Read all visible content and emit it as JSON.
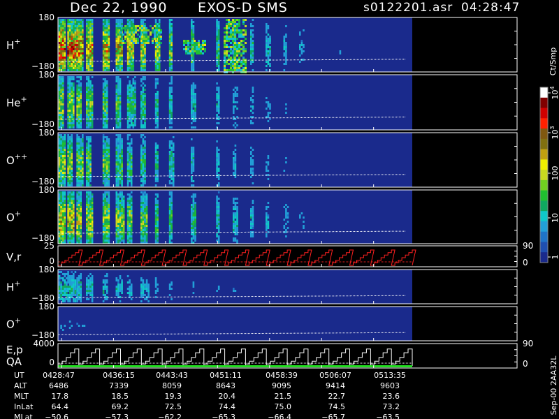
{
  "header": {
    "date": "Dec 22, 1990",
    "instrument": "EXOS-D SMS",
    "file": "s0122201.asr",
    "time": "04:28:47"
  },
  "colorbar": {
    "label": "Ct/Smp",
    "ticks": [
      "1",
      "10",
      "100",
      "10",
      "10"
    ],
    "tick_exponents": [
      "",
      "",
      "",
      "3",
      "4"
    ],
    "colors": [
      "#1a2a8c",
      "#1f4fb0",
      "#1f74c8",
      "#22a0d8",
      "#10c8c8",
      "#0fa860",
      "#20c030",
      "#70d020",
      "#c8d820",
      "#f0f000",
      "#c0a010",
      "#807010",
      "#805810",
      "#ff2000",
      "#d00000",
      "#800000",
      "#ffffff"
    ]
  },
  "panels": [
    {
      "label": "H",
      "sup": "+",
      "ymax": "180",
      "ymin": "−180"
    },
    {
      "label": "He",
      "sup": "+",
      "ymax": "180",
      "ymin": "−180"
    },
    {
      "label": "O",
      "sup": "++",
      "ymax": "180",
      "ymin": "−180"
    },
    {
      "label": "O",
      "sup": "+",
      "ymax": "180",
      "ymin": "−180"
    },
    {
      "label": "V,r",
      "sup": "",
      "ymax": "25",
      "ymin": "0",
      "right_max": "90",
      "right_min": "0"
    },
    {
      "label": "H",
      "sup": "+",
      "ymax": "180",
      "ymin": "−180"
    },
    {
      "label": "O",
      "sup": "+",
      "ymax": "180",
      "ymin": "−180"
    },
    {
      "label": "E,p",
      "sup": "",
      "label2": "QA",
      "ymax": "4000",
      "ymin": "0",
      "right_max": "90",
      "right_min": "0"
    }
  ],
  "side_note": "Sep-00 2AA32L",
  "ephemeris": {
    "rows": [
      {
        "name": "UT",
        "values": [
          "0428:47",
          "0436:15",
          "0443:43",
          "0451:11",
          "0458:39",
          "0506:07",
          "0513:35"
        ]
      },
      {
        "name": "ALT",
        "values": [
          "6486",
          "7339",
          "8059",
          "8643",
          "9095",
          "9414",
          "9603"
        ]
      },
      {
        "name": "MLT",
        "values": [
          "17.8",
          "18.5",
          "19.3",
          "20.4",
          "21.5",
          "22.7",
          "23.6"
        ]
      },
      {
        "name": "InLat",
        "values": [
          "64.4",
          "69.2",
          "72.5",
          "74.4",
          "75.0",
          "74.5",
          "73.2"
        ]
      },
      {
        "name": "MLat",
        "values": [
          "−50.6",
          "−57.3",
          "−62.2",
          "−65.3",
          "−66.4",
          "−65.7",
          "−63.5"
        ]
      }
    ]
  },
  "chart_data": {
    "type": "heatmap",
    "title": "Dec 22, 1990   EXOS-D SMS",
    "x_ticks": [
      "0428:47",
      "0436:15",
      "0443:43",
      "0451:11",
      "0458:39",
      "0506:07",
      "0513:35"
    ],
    "x_tick_positions_fraction": [
      0.0,
      0.1483,
      0.2966,
      0.4449,
      0.5932,
      0.7415,
      0.8898
    ],
    "data_end_fraction": 1.0,
    "colorbar_scale": "log",
    "colorbar_range": [
      1,
      10000
    ],
    "line_panels": [
      {
        "panel": "V,r",
        "type": "sawtooth",
        "periods": 17,
        "y_range": [
          0,
          25
        ],
        "color": "#ff2020"
      },
      {
        "panel": "E,p",
        "type": "staircase",
        "periods": 17,
        "y_range": [
          0,
          4000
        ],
        "color": "#ffffff"
      }
    ]
  }
}
